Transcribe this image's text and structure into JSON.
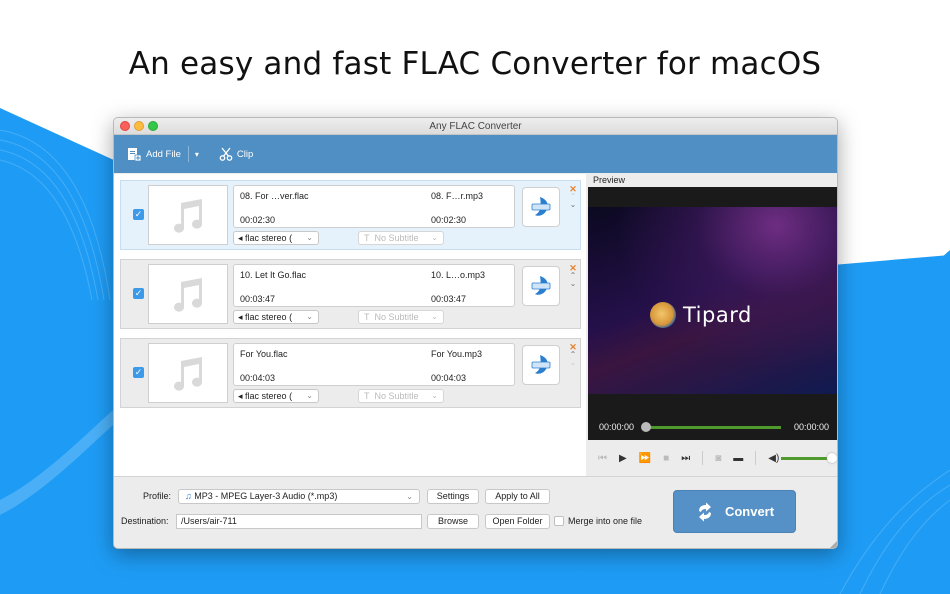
{
  "headline": "An easy and fast FLAC Converter for macOS",
  "window": {
    "title": "Any FLAC Converter"
  },
  "toolbar": {
    "add_file_label": "Add File",
    "dropdown_glyph": "▾",
    "clip_label": "Clip"
  },
  "files": [
    {
      "selected": true,
      "checked": true,
      "input_name": "08. For …ver.flac",
      "input_duration": "00:02:30",
      "output_name": "08. F…r.mp3",
      "output_duration": "00:02:30",
      "audio_track": "flac stereo (",
      "subtitle": "No Subtitle",
      "move_up_enabled": false,
      "move_down_enabled": true
    },
    {
      "selected": false,
      "checked": true,
      "input_name": "10. Let It Go.flac",
      "input_duration": "00:03:47",
      "output_name": "10. L…o.mp3",
      "output_duration": "00:03:47",
      "audio_track": "flac stereo (",
      "subtitle": "No Subtitle",
      "move_up_enabled": true,
      "move_down_enabled": true
    },
    {
      "selected": false,
      "checked": true,
      "input_name": "For You.flac",
      "input_duration": "00:04:03",
      "output_name": "For You.mp3",
      "output_duration": "00:04:03",
      "audio_track": "flac stereo (",
      "subtitle": "No Subtitle",
      "move_up_enabled": true,
      "move_down_enabled": false
    }
  ],
  "item_icons": {
    "checkbox": "✓",
    "remove": "✕",
    "up": "⌃",
    "down": "⌄",
    "chevron": "⌄",
    "speaker": "🔈",
    "subtitle": "T"
  },
  "preview": {
    "label": "Preview",
    "logo_text": "Tipard",
    "time_current": "00:00:00",
    "time_total": "00:00:00",
    "seek_progress": 0,
    "volume": 1.0
  },
  "bottom": {
    "profile_label": "Profile:",
    "profile_value": "MP3 - MPEG Layer-3 Audio (*.mp3)",
    "settings_label": "Settings",
    "apply_all_label": "Apply to All",
    "destination_label": "Destination:",
    "destination_value": "/Users/air-711",
    "browse_label": "Browse",
    "open_folder_label": "Open Folder",
    "merge_label": "Merge into one file",
    "merge_checked": false,
    "convert_label": "Convert"
  },
  "colors": {
    "toolbar_blue": "#4f8fc4",
    "convert_blue": "#5591c6",
    "background_blue": "#1e9cf5",
    "progress_green": "#4f9a2c",
    "remove_orange": "#e8822e"
  }
}
